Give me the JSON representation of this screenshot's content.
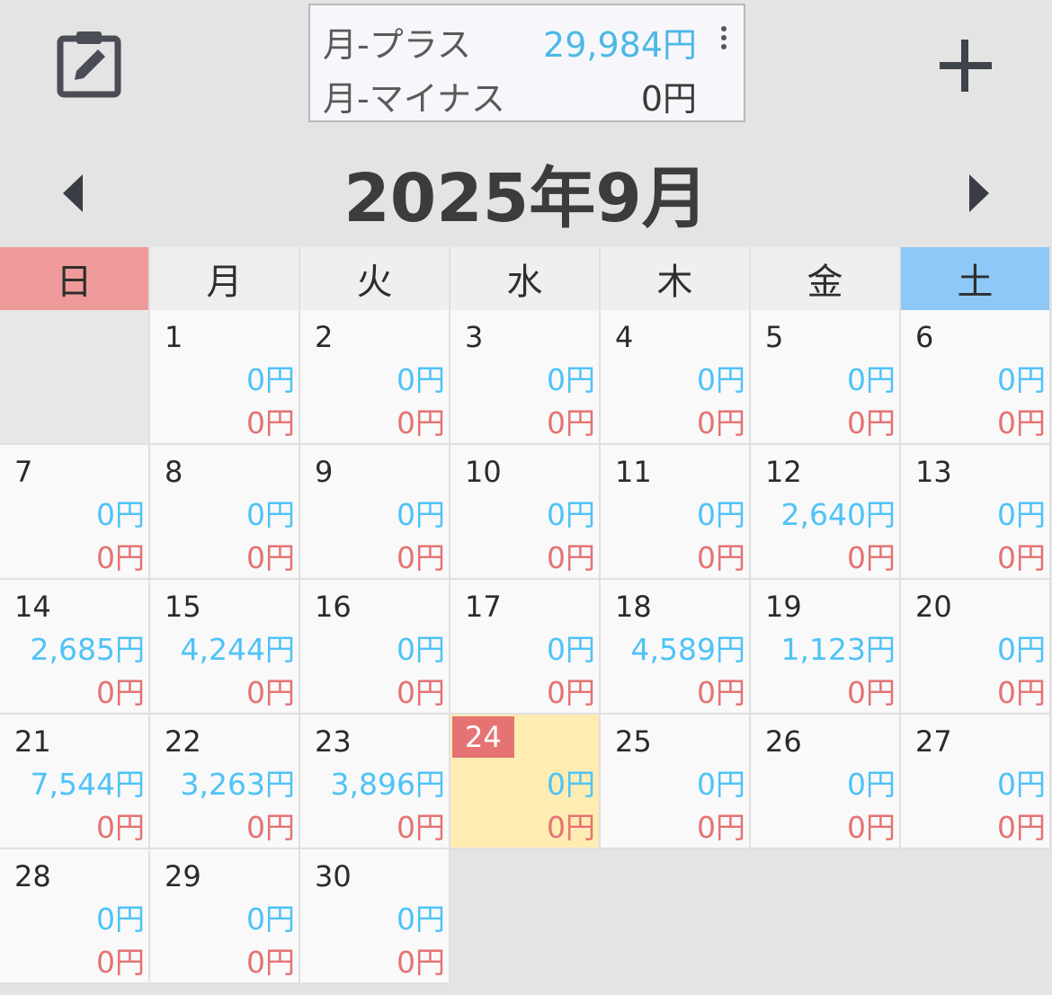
{
  "header": {
    "edit_icon": "edit-note-icon",
    "add_icon": "plus-icon",
    "more_icon": "more-vertical-icon",
    "summary": {
      "plus_label": "月-プラス",
      "plus_value": "29,984円",
      "minus_label": "月-マイナス",
      "minus_value": "0円"
    }
  },
  "nav": {
    "month_title": "2025年9月",
    "prev_icon": "triangle-left-icon",
    "next_icon": "triangle-right-icon"
  },
  "weekdays": [
    "日",
    "月",
    "火",
    "水",
    "木",
    "金",
    "土"
  ],
  "colors": {
    "sunday_header": "#ef9a9a",
    "saturday_header": "#8ec8f6",
    "plus_text": "#4fc3f7",
    "minus_text": "#e57373",
    "today_bg": "#ffecb3",
    "today_badge": "#e57373"
  },
  "calendar": {
    "leading_empty": 1,
    "today": "24",
    "days": [
      {
        "day": "1",
        "plus": "0円",
        "minus": "0円"
      },
      {
        "day": "2",
        "plus": "0円",
        "minus": "0円"
      },
      {
        "day": "3",
        "plus": "0円",
        "minus": "0円"
      },
      {
        "day": "4",
        "plus": "0円",
        "minus": "0円"
      },
      {
        "day": "5",
        "plus": "0円",
        "minus": "0円"
      },
      {
        "day": "6",
        "plus": "0円",
        "minus": "0円"
      },
      {
        "day": "7",
        "plus": "0円",
        "minus": "0円"
      },
      {
        "day": "8",
        "plus": "0円",
        "minus": "0円"
      },
      {
        "day": "9",
        "plus": "0円",
        "minus": "0円"
      },
      {
        "day": "10",
        "plus": "0円",
        "minus": "0円"
      },
      {
        "day": "11",
        "plus": "0円",
        "minus": "0円"
      },
      {
        "day": "12",
        "plus": "2,640円",
        "minus": "0円"
      },
      {
        "day": "13",
        "plus": "0円",
        "minus": "0円"
      },
      {
        "day": "14",
        "plus": "2,685円",
        "minus": "0円"
      },
      {
        "day": "15",
        "plus": "4,244円",
        "minus": "0円"
      },
      {
        "day": "16",
        "plus": "0円",
        "minus": "0円"
      },
      {
        "day": "17",
        "plus": "0円",
        "minus": "0円"
      },
      {
        "day": "18",
        "plus": "4,589円",
        "minus": "0円"
      },
      {
        "day": "19",
        "plus": "1,123円",
        "minus": "0円"
      },
      {
        "day": "20",
        "plus": "0円",
        "minus": "0円"
      },
      {
        "day": "21",
        "plus": "7,544円",
        "minus": "0円"
      },
      {
        "day": "22",
        "plus": "3,263円",
        "minus": "0円"
      },
      {
        "day": "23",
        "plus": "3,896円",
        "minus": "0円"
      },
      {
        "day": "24",
        "plus": "0円",
        "minus": "0円"
      },
      {
        "day": "25",
        "plus": "0円",
        "minus": "0円"
      },
      {
        "day": "26",
        "plus": "0円",
        "minus": "0円"
      },
      {
        "day": "27",
        "plus": "0円",
        "minus": "0円"
      },
      {
        "day": "28",
        "plus": "0円",
        "minus": "0円"
      },
      {
        "day": "29",
        "plus": "0円",
        "minus": "0円"
      },
      {
        "day": "30",
        "plus": "0円",
        "minus": "0円"
      }
    ]
  }
}
